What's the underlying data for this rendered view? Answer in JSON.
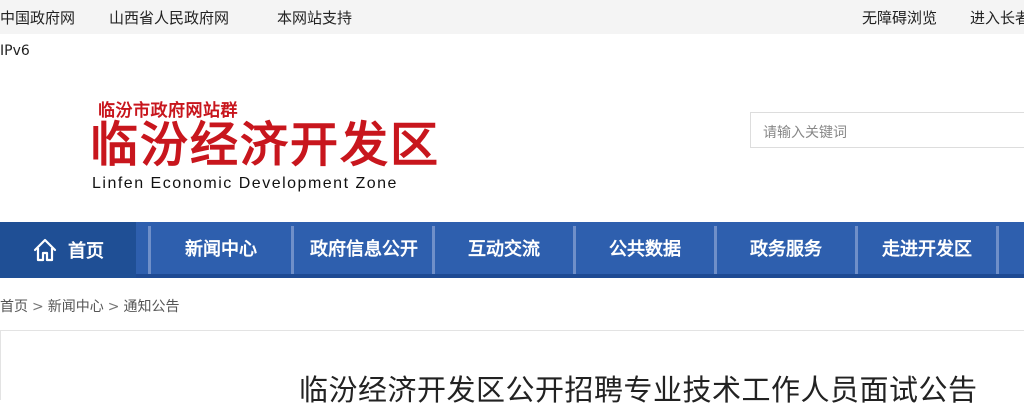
{
  "topbar": {
    "links": [
      "中国政府网",
      "山西省人民政府网",
      "本网站支持",
      "无障碍浏览",
      "进入长者"
    ]
  },
  "ipv6": "IPv6",
  "logo": {
    "sub": "临汾市政府网站群",
    "main": "临汾经济开发区",
    "en": "Linfen Economic Development Zone"
  },
  "search": {
    "placeholder": "请输入关键词"
  },
  "nav": {
    "items": [
      "首页",
      "新闻中心",
      "政府信息公开",
      "互动交流",
      "公共数据",
      "政务服务",
      "走进开发区"
    ]
  },
  "breadcrumb": {
    "items": [
      "首页",
      "新闻中心",
      "通知公告"
    ],
    "separator": ">"
  },
  "article": {
    "title": "临汾经济开发区公开招聘专业技术工作人员面试公告"
  },
  "colors": {
    "brand_red": "#c8161d",
    "nav_blue": "#2e5fae",
    "nav_home_blue": "#1f4f95"
  },
  "icons": {
    "home": "home-icon"
  }
}
